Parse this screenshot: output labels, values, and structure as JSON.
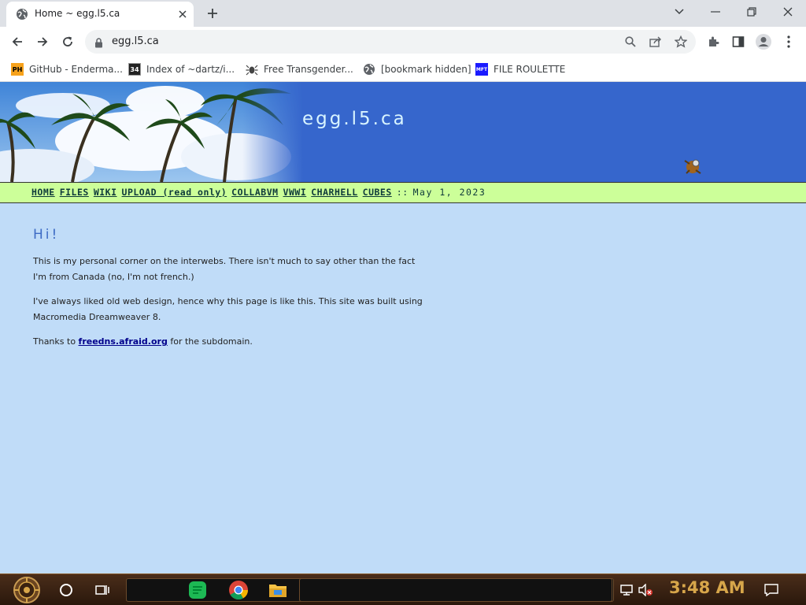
{
  "browser": {
    "tab": {
      "title": "Home ~ egg.l5.ca",
      "favicon": "globe-icon"
    },
    "address": {
      "url": "egg.l5.ca"
    }
  },
  "bookmarks": [
    {
      "label": "GitHub - Enderma...",
      "icon": "ph-icon",
      "icon_text": "PH",
      "icon_color": "#f7a21b"
    },
    {
      "label": "Index of ~dartz/i...",
      "icon": "index-icon",
      "icon_text": "34",
      "icon_color": "#222222"
    },
    {
      "label": "Free Transgender...",
      "icon": "spider-icon",
      "icon_text": "",
      "icon_color": "#444444"
    },
    {
      "label": "[bookmark hidden]",
      "icon": "globe-icon",
      "icon_text": "",
      "icon_color": "#5f6368"
    },
    {
      "label": "FILE ROULETTE",
      "icon": "mft-icon",
      "icon_text": "MFT",
      "icon_color": "#1a1aff"
    }
  ],
  "page": {
    "site_title": "egg.l5.ca",
    "nav": {
      "links": [
        "HOME",
        "FILES",
        "WIKI",
        "UPLOAD (read only)",
        "COLLABVM",
        "VWWI",
        "CHARHELL",
        "CUBES"
      ],
      "separator": "::",
      "date": "May 1, 2023"
    },
    "heading": "Hi!",
    "para1": "This is my personal corner on the interwebs. There isn't much to say other than the fact I'm from Canada (no, I'm not french.)",
    "para2": "I've always liked old web design, hence why this page is like this. This site was built using Macromedia Dreamweaver 8.",
    "para3_before": "Thanks to ",
    "para3_link": "freedns.afraid.org",
    "para3_after": " for the subdomain.",
    "colors": {
      "banner": "#3666cc",
      "navbar": "#ccff99",
      "background": "#c0dcf8",
      "heading": "#3d6bc4",
      "link": "#00008b"
    }
  },
  "taskbar": {
    "clock": "3:48 AM",
    "apps": [
      "start-orb-icon",
      "cortana-icon",
      "task-view-icon",
      "spotify-icon",
      "chrome-icon",
      "file-explorer-icon"
    ],
    "tray": [
      "network-icon",
      "volume-muted-icon",
      "notification-icon"
    ]
  }
}
